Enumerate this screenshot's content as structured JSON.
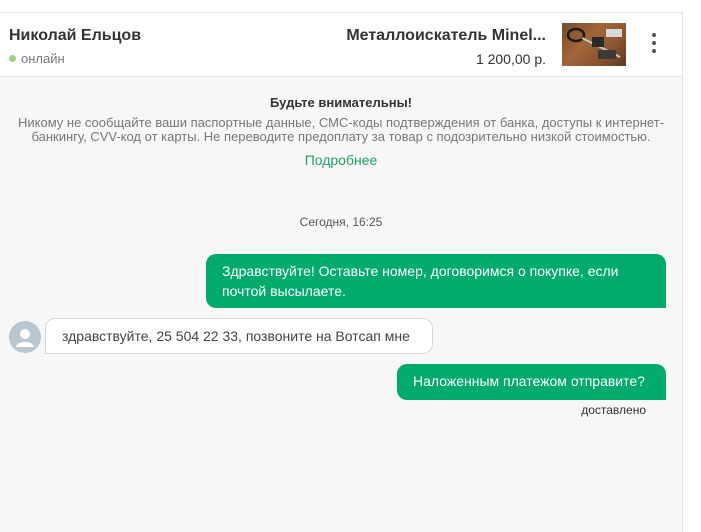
{
  "header": {
    "contact_name": "Николай Ельцов",
    "status": "онлайн",
    "item_title": "Металлоискатель Minel...",
    "item_price": "1 200,00 р.",
    "menu_icon": "more-vertical-icon"
  },
  "warning": {
    "title": "Будьте внимательны!",
    "text": "Никому не сообщайте ваши паспортные данные, СМС-коды подтверждения от банка, доступы к интернет-банкингу, CVV-код от карты. Не переводите предоплату за товар с подозрительно низкой стоимостью.",
    "link": "Подробнее"
  },
  "chat": {
    "date_separator": "Сегодня, 16:25",
    "messages": [
      {
        "direction": "out",
        "text": "Здравствуйте! Оставьте номер, договоримся о покупке, если почтой высылаете."
      },
      {
        "direction": "in",
        "text": "здравствуйте, 25 504 22 33, позвоните на Вотсап мне"
      },
      {
        "direction": "out",
        "text": "Наложенным платежом отправите?"
      }
    ],
    "delivery_status": "доставлено"
  },
  "colors": {
    "accent_green": "#00ab6c",
    "link_green": "#21a366",
    "online_dot": "#9ad47b"
  }
}
